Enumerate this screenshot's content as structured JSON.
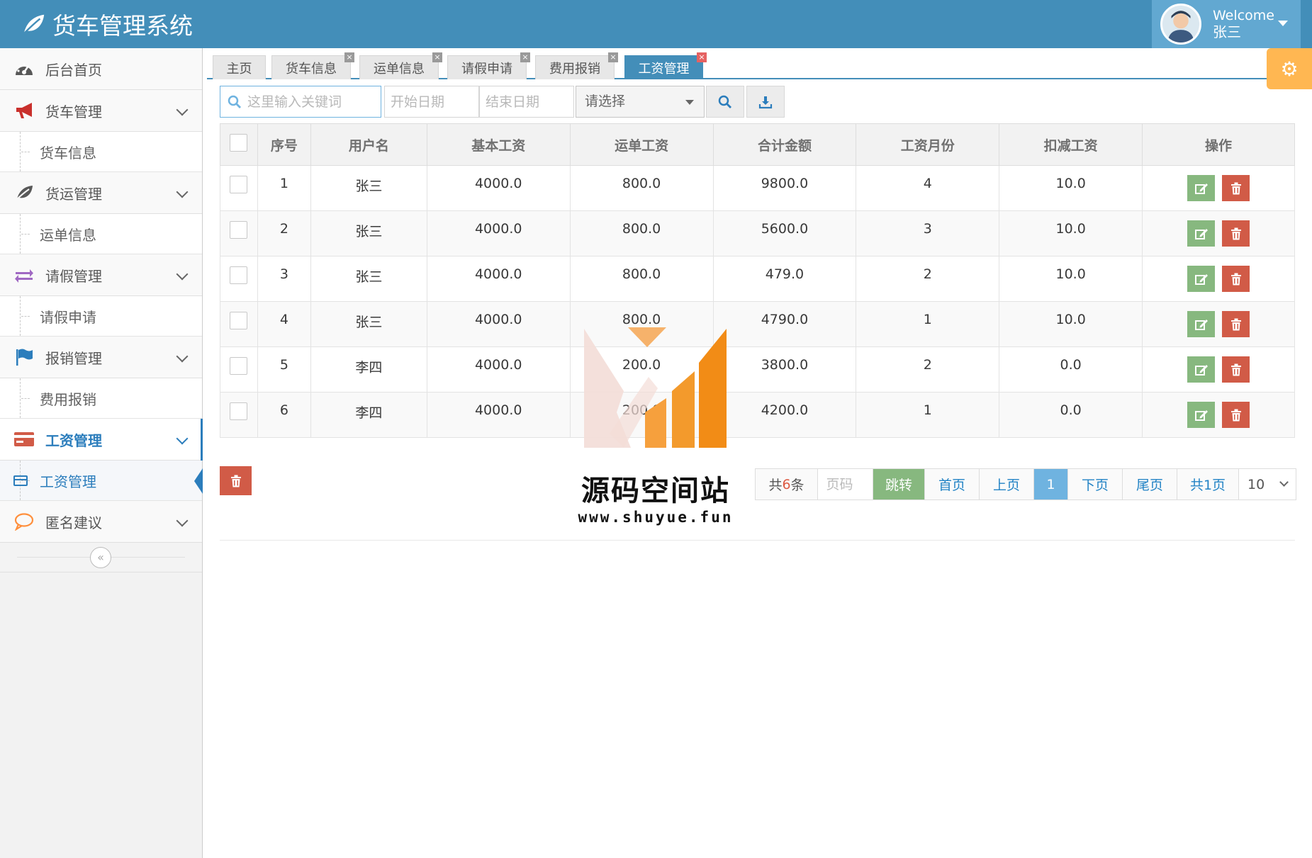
{
  "app": {
    "title": "货车管理系统"
  },
  "user": {
    "welcome": "Welcome",
    "name": "张三"
  },
  "sidebar": {
    "items": [
      {
        "label": "后台首页",
        "icon": "dashboard-icon"
      },
      {
        "label": "货车管理",
        "icon": "bullhorn-icon",
        "children": [
          "货车信息"
        ]
      },
      {
        "label": "货运管理",
        "icon": "leaf-icon",
        "children": [
          "运单信息"
        ]
      },
      {
        "label": "请假管理",
        "icon": "exchange-icon",
        "children": [
          "请假申请"
        ]
      },
      {
        "label": "报销管理",
        "icon": "flag-icon",
        "children": [
          "费用报销"
        ]
      },
      {
        "label": "工资管理",
        "icon": "credit-card-icon",
        "children": [
          "工资管理"
        ],
        "active": true
      },
      {
        "label": "匿名建议",
        "icon": "comment-icon"
      }
    ],
    "collapse_symbol": "«"
  },
  "tabs": [
    {
      "label": "主页"
    },
    {
      "label": "货车信息"
    },
    {
      "label": "运单信息"
    },
    {
      "label": "请假申请"
    },
    {
      "label": "费用报销"
    },
    {
      "label": "工资管理",
      "active": true
    }
  ],
  "toolbar": {
    "search_placeholder": "这里输入关键词",
    "start_date_placeholder": "开始日期",
    "end_date_placeholder": "结束日期",
    "select_placeholder": "请选择"
  },
  "table": {
    "columns": [
      "序号",
      "用户名",
      "基本工资",
      "运单工资",
      "合计金额",
      "工资月份",
      "扣减工资",
      "操作"
    ],
    "rows": [
      [
        "1",
        "张三",
        "4000.0",
        "800.0",
        "9800.0",
        "4",
        "10.0"
      ],
      [
        "2",
        "张三",
        "4000.0",
        "800.0",
        "5600.0",
        "3",
        "10.0"
      ],
      [
        "3",
        "张三",
        "4000.0",
        "800.0",
        "479.0",
        "2",
        "10.0"
      ],
      [
        "4",
        "张三",
        "4000.0",
        "800.0",
        "4790.0",
        "1",
        "10.0"
      ],
      [
        "5",
        "李四",
        "4000.0",
        "200.0",
        "3800.0",
        "2",
        "0.0"
      ],
      [
        "6",
        "李四",
        "4000.0",
        "200.0",
        "4200.0",
        "1",
        "0.0"
      ]
    ]
  },
  "pager": {
    "total_prefix": "共",
    "total_count": "6",
    "total_suffix": "条",
    "page_placeholder": "页码",
    "jump": "跳转",
    "first": "首页",
    "prev": "上页",
    "current": "1",
    "next": "下页",
    "last": "尾页",
    "pages": "共1页",
    "page_size": "10"
  },
  "watermark": {
    "title": "源码空间站",
    "url": "www.shuyue.fun"
  },
  "colors": {
    "header": "#438eb9",
    "accent": "#2b7dbc",
    "edit": "#87b87f",
    "delete": "#d15b47",
    "gear": "#ffb752"
  }
}
